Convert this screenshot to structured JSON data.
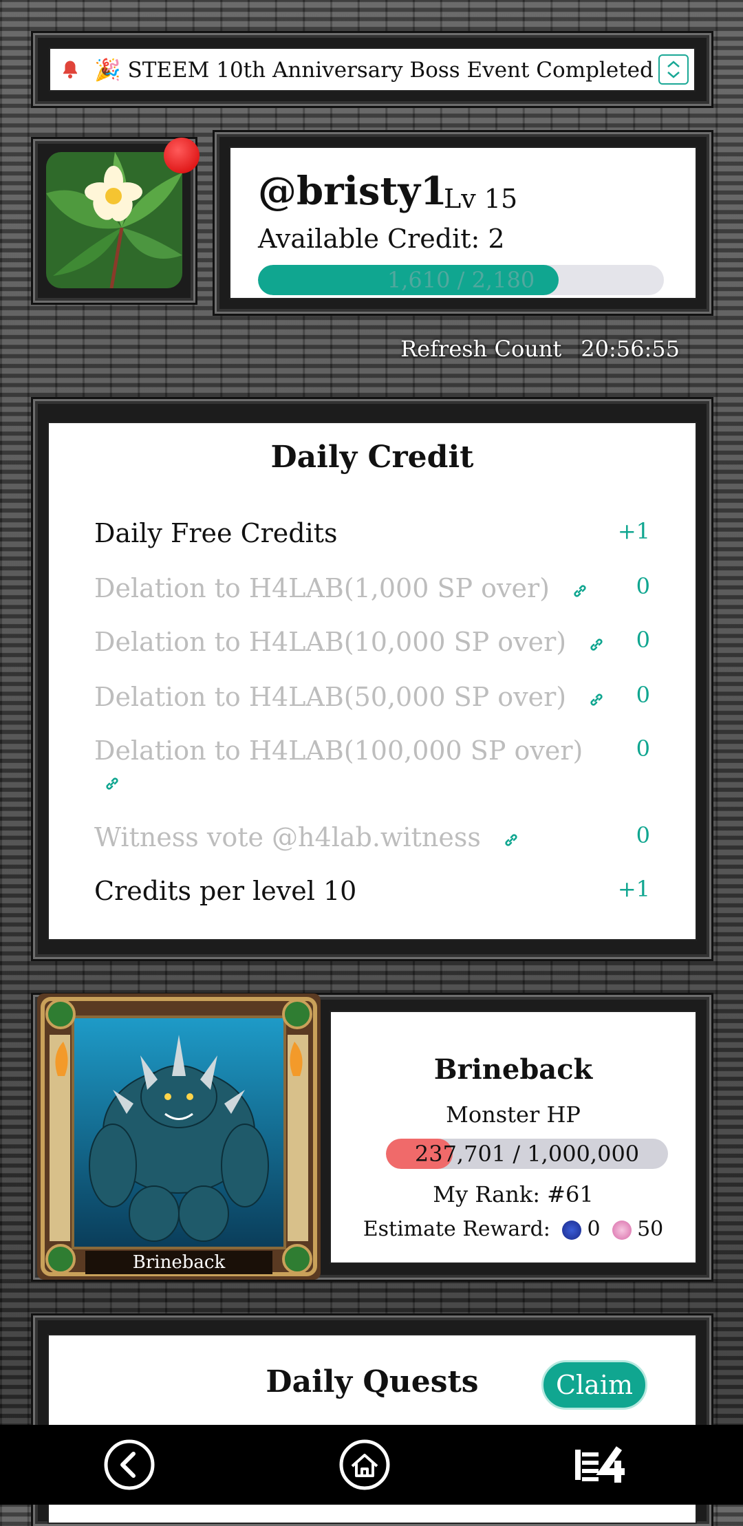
{
  "notice": {
    "text": "🎉 STEEM 10th Anniversary Boss Event Completed !"
  },
  "profile": {
    "username": "@bristy1",
    "level": "Lv 15",
    "credit_label": "Available Credit: 2",
    "xp_text": "1,610 / 2,180",
    "xp_progress": 0.74
  },
  "refresh": {
    "label": "Refresh Count",
    "time": "20:56:55"
  },
  "daily_credit": {
    "title": "Daily Credit",
    "rows": [
      {
        "label": "Daily Free Credits",
        "value": "+1"
      },
      {
        "label": "Delation to H4LAB(1,000 SP over)",
        "value": "0"
      },
      {
        "label": "Delation to H4LAB(10,000 SP over)",
        "value": "0"
      },
      {
        "label": "Delation to H4LAB(50,000 SP over)",
        "value": "0"
      },
      {
        "label": "Delation to H4LAB(100,000 SP over)",
        "value": "0"
      },
      {
        "label": "Witness vote @h4lab.witness",
        "value": "0"
      },
      {
        "label": "Credits per level 10",
        "value": "+1"
      }
    ]
  },
  "monster": {
    "name": "Brineback",
    "card_name": "Brineback",
    "hp_label": "Monster HP",
    "hp_text": "237,701 / 1,000,000",
    "hp_fraction": 0.237701,
    "rank": "My Rank: #61",
    "reward_label": "Estimate Reward:",
    "reward_steem": "0",
    "reward_token": "50"
  },
  "quests": {
    "title": "Daily Quests",
    "claim": "Claim"
  },
  "colors": {
    "accent": "#10a690",
    "hp": "#f06a6a",
    "dot": "#d40000"
  },
  "nav": {
    "icons": [
      "back-icon",
      "home-icon",
      "h4-logo"
    ]
  }
}
